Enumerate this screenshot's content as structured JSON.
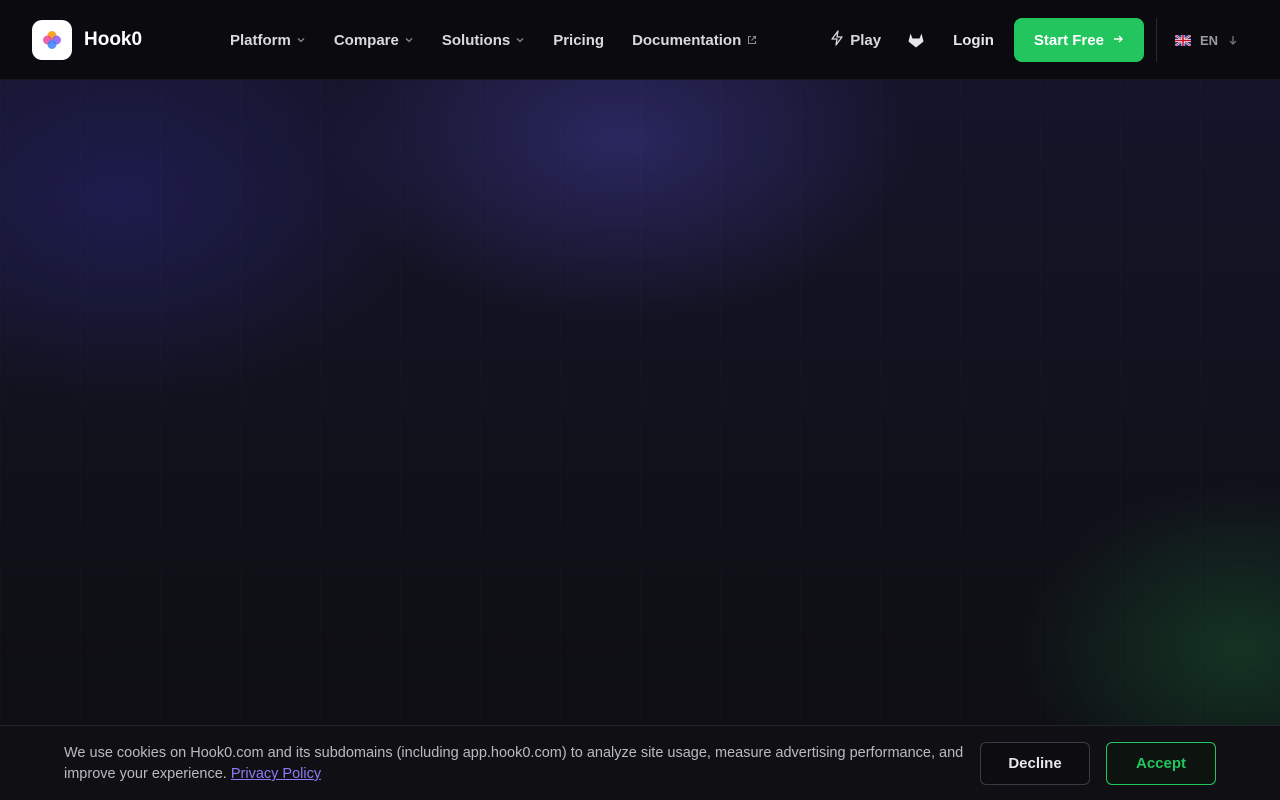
{
  "brand": {
    "name": "Hook0",
    "logo_icon": "hook0-logo-icon"
  },
  "nav": {
    "items": [
      {
        "label": "Platform",
        "icon": "chevron-down-icon"
      },
      {
        "label": "Compare",
        "icon": "chevron-down-icon"
      },
      {
        "label": "Solutions",
        "icon": "chevron-down-icon"
      },
      {
        "label": "Pricing"
      },
      {
        "label": "Documentation",
        "icon": "external-link-icon"
      }
    ],
    "play_label": "Play",
    "gitlab_icon": "gitlab-icon",
    "login_label": "Login",
    "cta_label": "Start Free",
    "language": "EN"
  },
  "cookie_banner": {
    "text": "We use cookies on Hook0.com and its subdomains (including app.hook0.com) to analyze site usage, measure advertising performance, and improve your experience.",
    "link_label": "Privacy Policy",
    "decline_label": "Decline",
    "accept_label": "Accept"
  },
  "colors": {
    "accent_green": "#22c55e",
    "link_purple": "#8b7cf6",
    "background": "#0d0d12"
  }
}
